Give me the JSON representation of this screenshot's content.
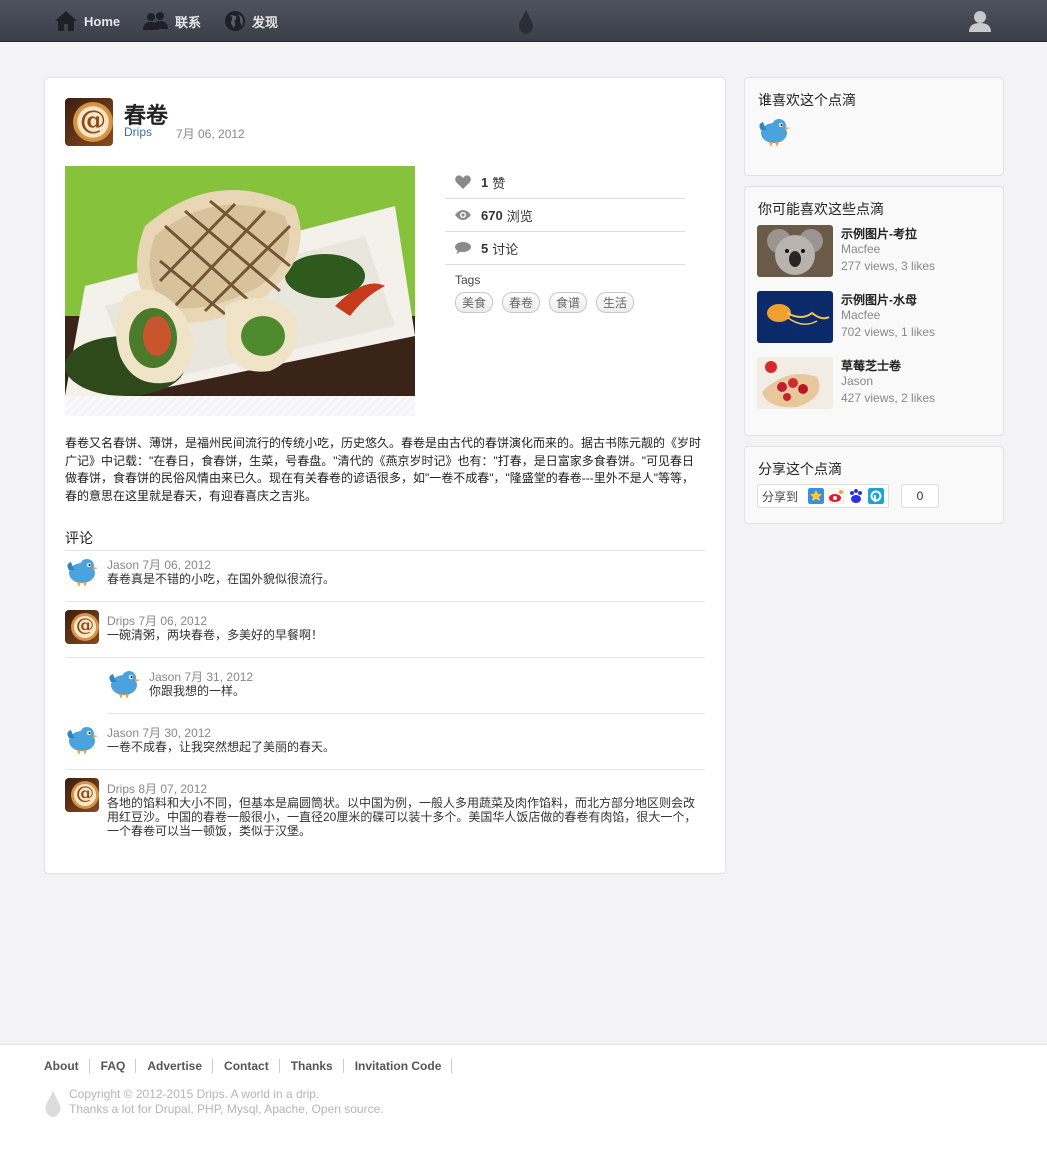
{
  "nav": {
    "home": "Home",
    "contact": "联系",
    "discover": "发现"
  },
  "post": {
    "title": "春卷",
    "author": "Drips",
    "date": "7月 06, 2012",
    "likes_count": "1",
    "likes_label": "赞",
    "views_count": "670",
    "views_label": "浏览",
    "discuss_count": "5",
    "discuss_label": "讨论",
    "tags_label": "Tags",
    "tags": [
      "美食",
      "春卷",
      "食谱",
      "生活"
    ],
    "body": "春卷又名春饼、薄饼，是福州民间流行的传统小吃，历史悠久。春卷是由古代的春饼演化而来的。据古书陈元靓的《岁时广记》中记载：\"在春日，食春饼，生菜，号春盘。\"清代的《燕京岁时记》也有：\"打春，是日富家多食春饼。\"可见春日做春饼，食春饼的民俗风情由来已久。现在有关春卷的谚语很多，如\"一卷不成春\"，\"隆盛堂的春卷---里外不是人\"等等，春的意思在这里就是春天，有迎春喜庆之吉兆。"
  },
  "comments": {
    "heading": "评论",
    "items": [
      {
        "author": "Jason",
        "date": "7月 06, 2012",
        "text": "春卷真是不错的小吃，在国外貌似很流行。"
      },
      {
        "author": "Drips",
        "date": "7月 06, 2012",
        "text": "一碗清粥，两块春卷，多美好的早餐啊！"
      },
      {
        "author": "Jason",
        "date": "7月 31, 2012",
        "text": "你跟我想的一样。"
      },
      {
        "author": "Jason",
        "date": "7月 30, 2012",
        "text": "一卷不成春，让我突然想起了美丽的春天。"
      },
      {
        "author": "Drips",
        "date": "8月 07, 2012",
        "text": "各地的馅料和大小不同，但基本是扁圆筒状。以中国为例，一般人多用蔬菜及肉作馅料，而北方部分地区则会改用红豆沙。中国的春卷一般很小，一直径20厘米的碟可以装十多个。美国华人饭店做的春卷有肉馅，很大一个，一个春卷可以当一顿饭，类似于汉堡。"
      }
    ]
  },
  "sidebar": {
    "who_likes_title": "谁喜欢这个点滴",
    "you_may_title": "你可能喜欢这些点滴",
    "recommendations": [
      {
        "title": "示例图片-考拉",
        "author": "Macfee",
        "stats": "277 views, 3 likes"
      },
      {
        "title": "示例图片-水母",
        "author": "Macfee",
        "stats": "702 views, 1 likes"
      },
      {
        "title": "草莓芝士卷",
        "author": "Jason",
        "stats": "427 views, 2 likes"
      }
    ],
    "share_title": "分享这个点滴",
    "share_label": "分享到",
    "share_count": "0"
  },
  "footer": {
    "links": [
      "About",
      "FAQ",
      "Advertise",
      "Contact",
      "Thanks",
      "Invitation Code"
    ],
    "copyright": "Copyright © 2012-2015 Drips. A world in a drip.",
    "thanks": "Thanks a lot for Drupal, PHP, Mysql, Apache, Open source."
  },
  "colors": {
    "topbar": "#43474f",
    "link": "#3a6ea5",
    "background": "#f3f3f6"
  }
}
